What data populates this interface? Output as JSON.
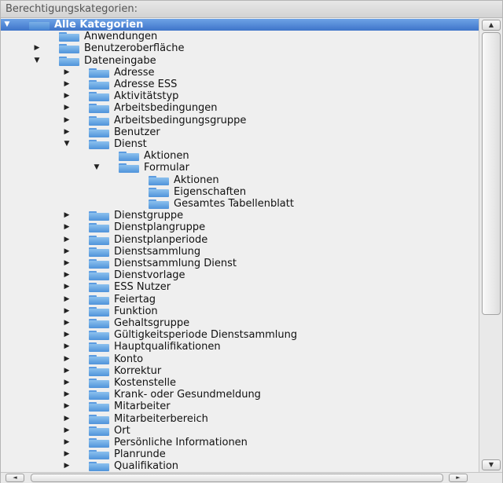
{
  "panel": {
    "title": "Berechtigungskategorien:"
  },
  "tree": {
    "nodes": [
      {
        "label": "Alle Kategorien",
        "depth": 0,
        "toggle": "expanded",
        "selected": true
      },
      {
        "label": "Anwendungen",
        "depth": 1,
        "toggle": "none"
      },
      {
        "label": "Benutzeroberfläche",
        "depth": 1,
        "toggle": "collapsed"
      },
      {
        "label": "Dateneingabe",
        "depth": 1,
        "toggle": "expanded"
      },
      {
        "label": "Adresse",
        "depth": 2,
        "toggle": "collapsed"
      },
      {
        "label": "Adresse ESS",
        "depth": 2,
        "toggle": "collapsed"
      },
      {
        "label": "Aktivitätstyp",
        "depth": 2,
        "toggle": "collapsed"
      },
      {
        "label": "Arbeitsbedingungen",
        "depth": 2,
        "toggle": "collapsed"
      },
      {
        "label": "Arbeitsbedingungsgruppe",
        "depth": 2,
        "toggle": "collapsed"
      },
      {
        "label": "Benutzer",
        "depth": 2,
        "toggle": "collapsed"
      },
      {
        "label": "Dienst",
        "depth": 2,
        "toggle": "expanded"
      },
      {
        "label": "Aktionen",
        "depth": 3,
        "toggle": "none"
      },
      {
        "label": "Formular",
        "depth": 3,
        "toggle": "expanded"
      },
      {
        "label": "Aktionen",
        "depth": 4,
        "toggle": "none"
      },
      {
        "label": "Eigenschaften",
        "depth": 4,
        "toggle": "none"
      },
      {
        "label": "Gesamtes Tabellenblatt",
        "depth": 4,
        "toggle": "none"
      },
      {
        "label": "Dienstgruppe",
        "depth": 2,
        "toggle": "collapsed"
      },
      {
        "label": "Dienstplangruppe",
        "depth": 2,
        "toggle": "collapsed"
      },
      {
        "label": "Dienstplanperiode",
        "depth": 2,
        "toggle": "collapsed"
      },
      {
        "label": "Dienstsammlung",
        "depth": 2,
        "toggle": "collapsed"
      },
      {
        "label": "Dienstsammlung Dienst",
        "depth": 2,
        "toggle": "collapsed"
      },
      {
        "label": "Dienstvorlage",
        "depth": 2,
        "toggle": "collapsed"
      },
      {
        "label": "ESS Nutzer",
        "depth": 2,
        "toggle": "collapsed"
      },
      {
        "label": "Feiertag",
        "depth": 2,
        "toggle": "collapsed"
      },
      {
        "label": "Funktion",
        "depth": 2,
        "toggle": "collapsed"
      },
      {
        "label": "Gehaltsgruppe",
        "depth": 2,
        "toggle": "collapsed"
      },
      {
        "label": "Gültigkeitsperiode Dienstsammlung",
        "depth": 2,
        "toggle": "collapsed"
      },
      {
        "label": "Hauptqualifikationen",
        "depth": 2,
        "toggle": "collapsed"
      },
      {
        "label": "Konto",
        "depth": 2,
        "toggle": "collapsed"
      },
      {
        "label": "Korrektur",
        "depth": 2,
        "toggle": "collapsed"
      },
      {
        "label": "Kostenstelle",
        "depth": 2,
        "toggle": "collapsed"
      },
      {
        "label": "Krank- oder Gesundmeldung",
        "depth": 2,
        "toggle": "collapsed"
      },
      {
        "label": "Mitarbeiter",
        "depth": 2,
        "toggle": "collapsed"
      },
      {
        "label": "Mitarbeiterbereich",
        "depth": 2,
        "toggle": "collapsed"
      },
      {
        "label": "Ort",
        "depth": 2,
        "toggle": "collapsed"
      },
      {
        "label": "Persönliche Informationen",
        "depth": 2,
        "toggle": "collapsed"
      },
      {
        "label": "Planrunde",
        "depth": 2,
        "toggle": "collapsed"
      },
      {
        "label": "Qualifikation",
        "depth": 2,
        "toggle": "collapsed"
      }
    ]
  },
  "icons": {
    "node": "folder-icon",
    "expanded": "triangle-down-icon",
    "collapsed": "triangle-right-icon"
  },
  "colors": {
    "selection": "#3e74c9",
    "folder": "#5b9be0"
  },
  "scrollbars": {
    "up": "▲",
    "down": "▼",
    "left": "◄",
    "right": "►"
  }
}
